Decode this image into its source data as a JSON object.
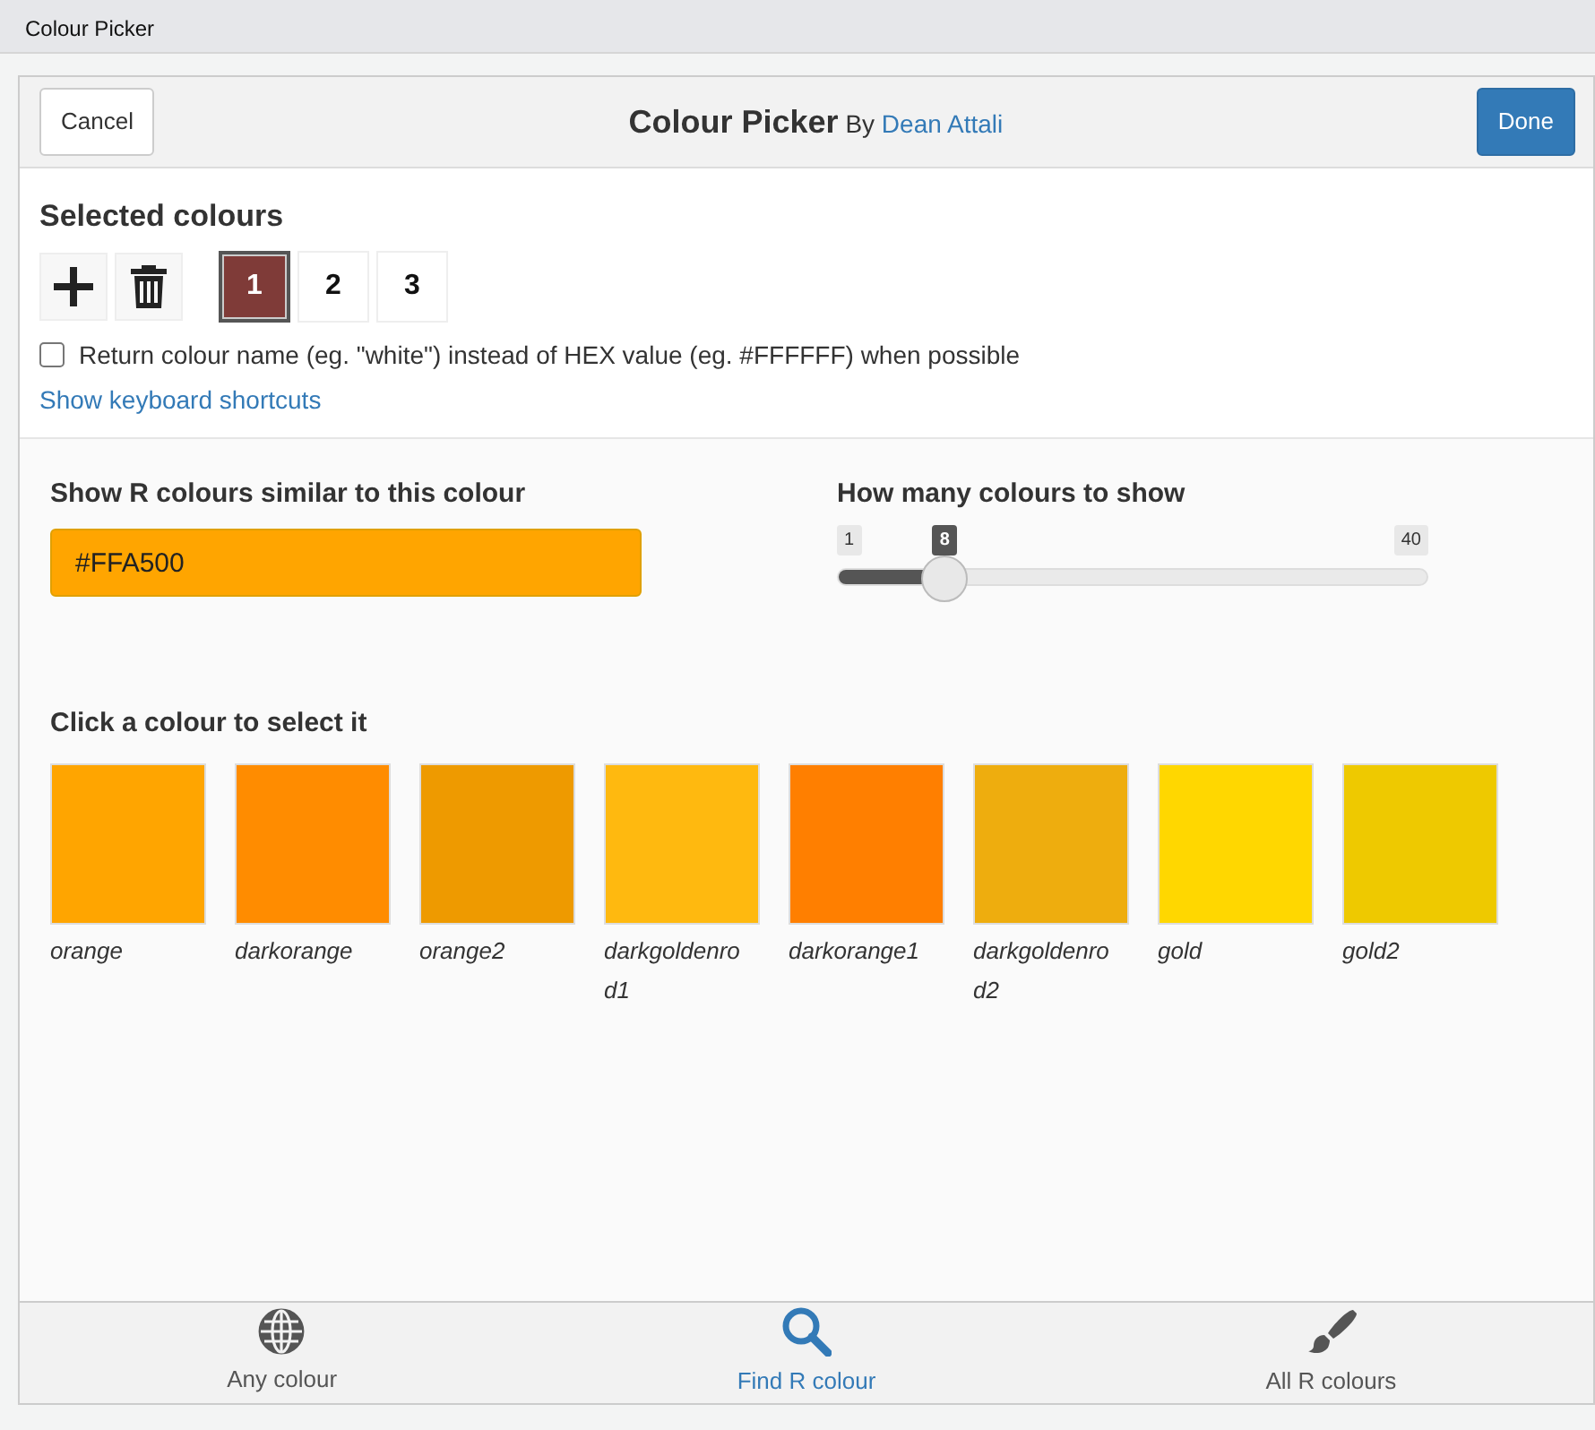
{
  "window": {
    "title": "Colour Picker"
  },
  "header": {
    "cancel": "Cancel",
    "title": "Colour Picker",
    "by": "By",
    "author": "Dean Attali",
    "done": "Done"
  },
  "selected_colours": {
    "heading": "Selected colours",
    "slots": [
      {
        "label": "1",
        "color": "#7f3b38",
        "selected": true
      },
      {
        "label": "2",
        "color": "#ffffff",
        "selected": false
      },
      {
        "label": "3",
        "color": "#ffffff",
        "selected": false
      }
    ]
  },
  "return_name": {
    "label": "Return colour name (eg. \"white\") instead of HEX value (eg. #FFFFFF) when possible",
    "checked": false
  },
  "shortcuts_link": "Show keyboard shortcuts",
  "similar": {
    "label": "Show R colours similar to this colour",
    "value": "#FFA500"
  },
  "count": {
    "label": "How many colours to show",
    "min": "1",
    "max": "40",
    "value": "8",
    "level": 0.18
  },
  "results": {
    "heading": "Click a colour to select it",
    "swatches": [
      {
        "name": "orange",
        "color": "#ffa500"
      },
      {
        "name": "darkorange",
        "color": "#ff8c00"
      },
      {
        "name": "orange2",
        "color": "#ee9a00"
      },
      {
        "name": "darkgoldenrod1",
        "color": "#ffb90f"
      },
      {
        "name": "darkorange1",
        "color": "#ff7f00"
      },
      {
        "name": "darkgoldenrod2",
        "color": "#eead0e"
      },
      {
        "name": "gold",
        "color": "#ffd700"
      },
      {
        "name": "gold2",
        "color": "#eec900"
      }
    ]
  },
  "tabs": [
    {
      "label": "Any colour",
      "kind": "globe",
      "selected": false
    },
    {
      "label": "Find R colour",
      "kind": "search",
      "selected": true
    },
    {
      "label": "All R colours",
      "kind": "brush",
      "selected": false
    }
  ]
}
